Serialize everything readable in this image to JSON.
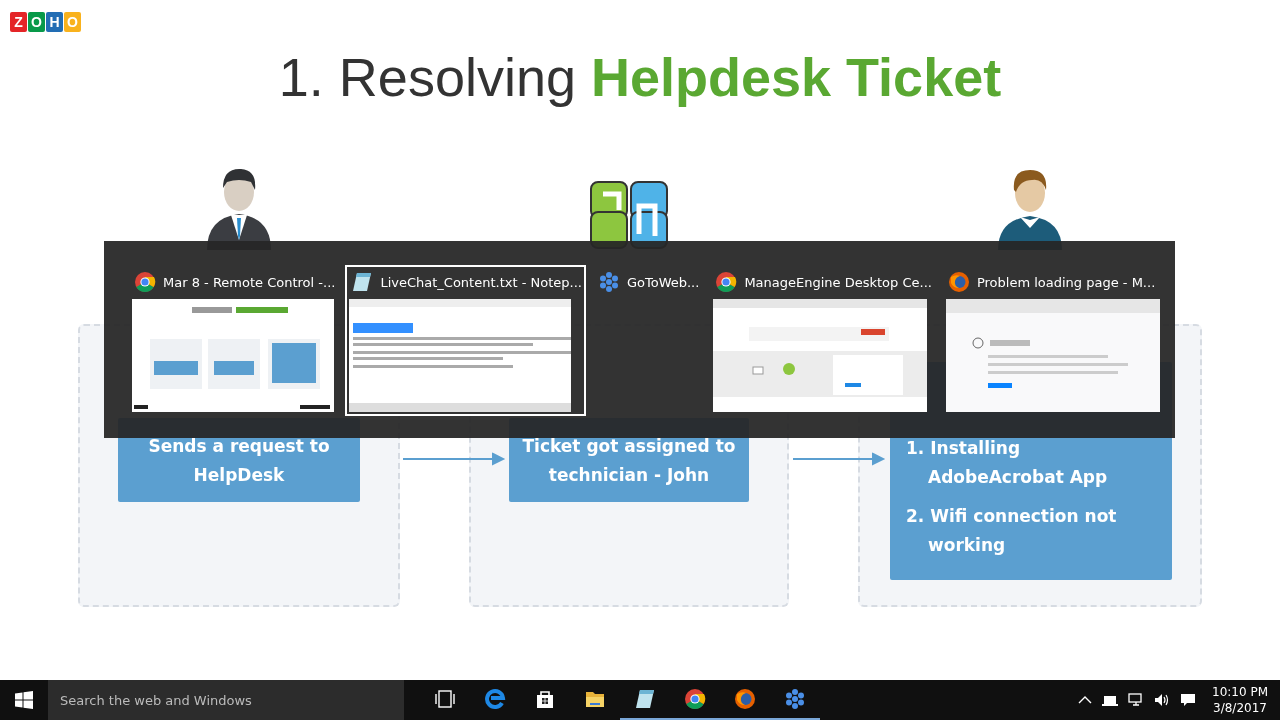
{
  "logo": {
    "letters": [
      {
        "text": "Z",
        "color": "#e42527"
      },
      {
        "text": "O",
        "color": "#089949"
      },
      {
        "text": "H",
        "color": "#226db4"
      },
      {
        "text": "O",
        "color": "#f9b21d"
      }
    ]
  },
  "slide": {
    "title": "1. Resolving **Helpdesk Ticket**",
    "columns": [
      {
        "figure": {
          "kind": "businessman"
        },
        "steps": [
          "Sends a request to HelpDesk"
        ]
      },
      {
        "figure": {
          "kind": "tiles"
        },
        "steps": [
          "Ticket got assigned to technician - John"
        ]
      },
      {
        "figure": {
          "kind": "person"
        },
        "steps": [
          "1. Installing AdobeAcrobat App",
          "2. Wifi connection not working"
        ]
      }
    ]
  },
  "switcher": {
    "windows": [
      {
        "icon": {
          "kind": "chrome"
        },
        "title": "Mar 8 - Remote Control -...",
        "selected": false,
        "thumbnail": {
          "kind": "slide"
        }
      },
      {
        "icon": {
          "kind": "notepad"
        },
        "title": "LiveChat_Content.txt - Notep...",
        "selected": true,
        "thumbnail": {
          "kind": "text"
        }
      },
      {
        "icon": {
          "kind": "snowflake"
        },
        "title": "GoToWeb...",
        "selected": false
      },
      {
        "icon": {
          "kind": "chrome"
        },
        "title": "ManageEngine Desktop Ce...",
        "selected": false,
        "thumbnail": {
          "kind": "web"
        }
      },
      {
        "icon": {
          "kind": "firefox"
        },
        "title": "Problem loading page - M...",
        "selected": false,
        "thumbnail": {
          "kind": "error"
        }
      }
    ]
  },
  "taskbar": {
    "search": {
      "placeholder": "Search the web and Windows"
    },
    "apps": [
      {
        "kind": "taskview",
        "running": false
      },
      {
        "kind": "edge",
        "running": false
      },
      {
        "kind": "store",
        "running": false
      },
      {
        "kind": "folder",
        "running": false
      },
      {
        "kind": "notepad",
        "running": true
      },
      {
        "kind": "chrome",
        "running": true
      },
      {
        "kind": "firefox",
        "running": true
      },
      {
        "kind": "snowflake",
        "running": true
      }
    ],
    "clock": {
      "time": "10:10 PM",
      "date": "3/8/2017"
    }
  }
}
